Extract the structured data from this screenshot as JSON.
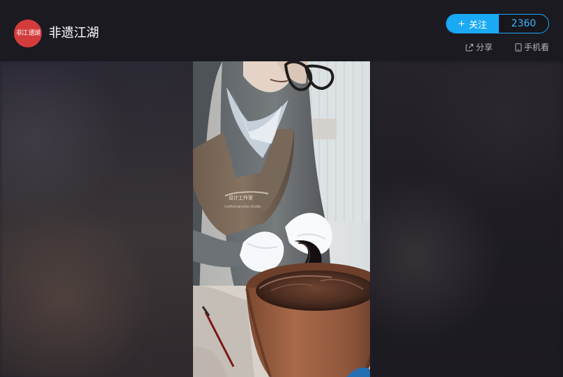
{
  "channel": {
    "name": "非遗江湖",
    "avatar_text": "非江\n遗湖"
  },
  "follow": {
    "button_plus": "+",
    "button_label": "关注",
    "count": "2360"
  },
  "actions": {
    "share_label": "分享",
    "phone_label": "手机看"
  },
  "video": {
    "alt_subject": ""
  },
  "colors": {
    "accent": "#19a9f5",
    "avatar_red": "#d43c3c",
    "background": "#1b1a21"
  },
  "icons": {
    "share": "share-icon",
    "phone": "phone-icon"
  }
}
